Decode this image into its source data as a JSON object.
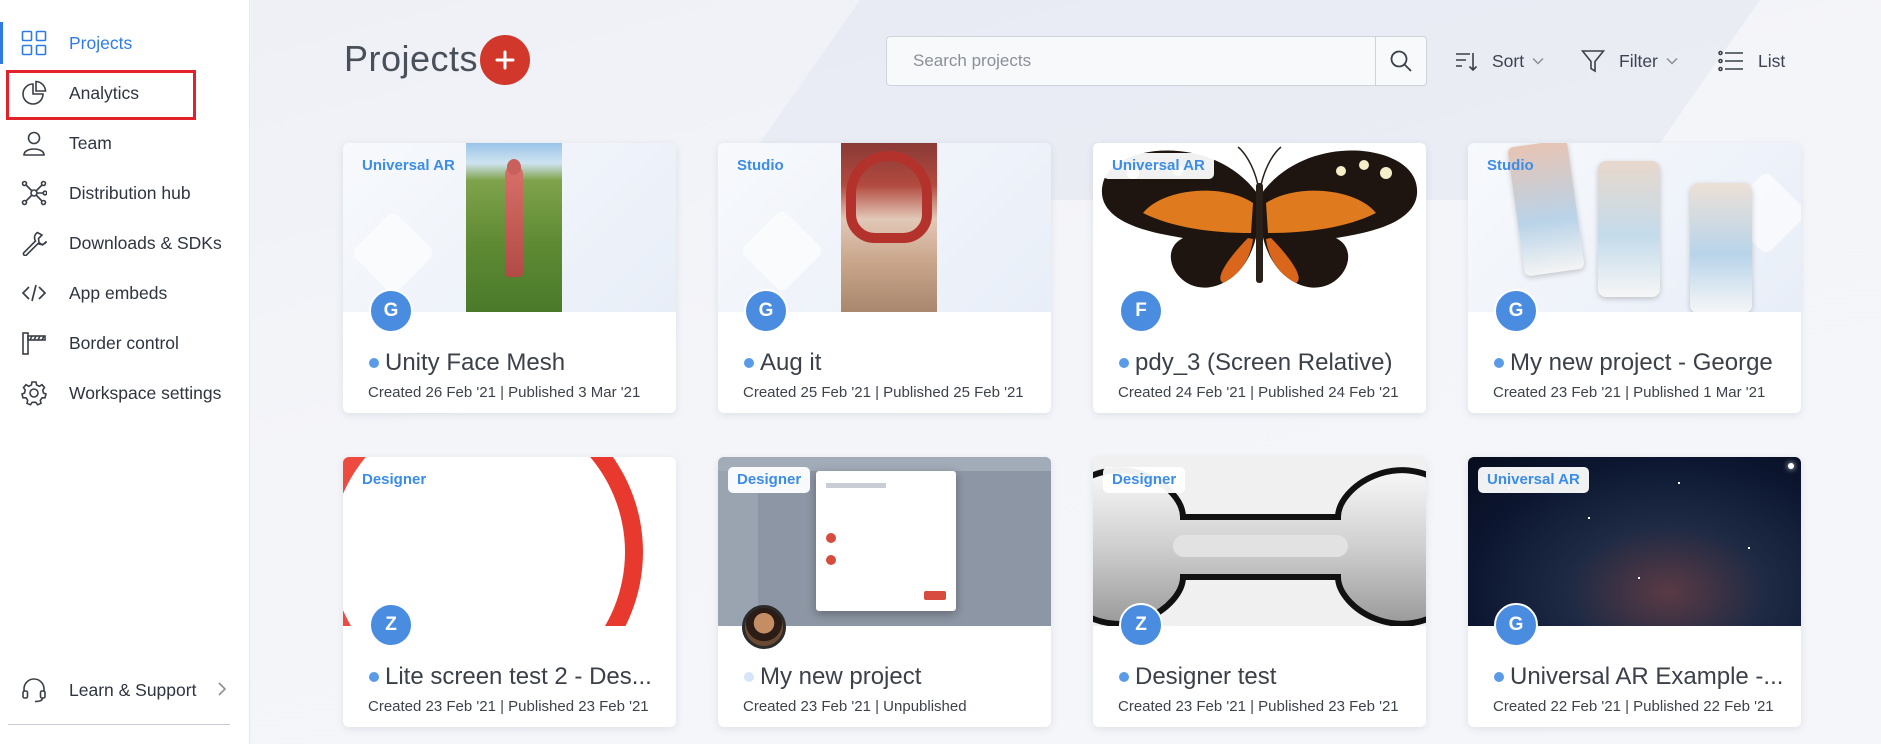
{
  "sidebar": {
    "items": [
      {
        "label": "Projects",
        "icon": "grid-icon",
        "active": true
      },
      {
        "label": "Analytics",
        "icon": "pie-chart-icon",
        "active": false
      },
      {
        "label": "Team",
        "icon": "user-icon",
        "active": false
      },
      {
        "label": "Distribution hub",
        "icon": "network-icon",
        "active": false
      },
      {
        "label": "Downloads & SDKs",
        "icon": "wrench-icon",
        "active": false
      },
      {
        "label": "App embeds",
        "icon": "code-icon",
        "active": false
      },
      {
        "label": "Border control",
        "icon": "barrier-icon",
        "active": false
      },
      {
        "label": "Workspace settings",
        "icon": "gear-icon",
        "active": false
      }
    ],
    "support": {
      "label": "Learn & Support",
      "icon": "headset-icon"
    }
  },
  "header": {
    "title": "Projects",
    "search_placeholder": "Search projects",
    "sort_label": "Sort",
    "filter_label": "Filter",
    "list_label": "List"
  },
  "projects": [
    {
      "tag": "Universal AR",
      "title": "Unity Face Mesh",
      "meta": "Created 26 Feb '21 | Published 3 Mar '21",
      "avatar": "G",
      "published": true
    },
    {
      "tag": "Studio",
      "title": "Aug it",
      "meta": "Created 25 Feb '21 | Published 25 Feb '21",
      "avatar": "G",
      "published": true
    },
    {
      "tag": "Universal AR",
      "title": "pdy_3 (Screen Relative)",
      "meta": "Created 24 Feb '21 | Published 24 Feb '21",
      "avatar": "F",
      "published": true
    },
    {
      "tag": "Studio",
      "title": "My new project - George",
      "meta": "Created 23 Feb '21 | Published 1 Mar '21",
      "avatar": "G",
      "published": true
    },
    {
      "tag": "Designer",
      "title": "Lite screen test 2 - Des...",
      "meta": "Created 23 Feb '21 | Published 23 Feb '21",
      "avatar": "Z",
      "published": true
    },
    {
      "tag": "Designer",
      "title": "My new project",
      "meta": "Created 23 Feb '21 | Unpublished",
      "avatar": "",
      "published": false
    },
    {
      "tag": "Designer",
      "title": "Designer test",
      "meta": "Created 23 Feb '21 | Published 23 Feb '21",
      "avatar": "Z",
      "published": true
    },
    {
      "tag": "Universal AR",
      "title": "Universal AR Example -...",
      "meta": "Created 22 Feb '21 | Published 22 Feb '21",
      "avatar": "G",
      "published": true
    }
  ],
  "colors": {
    "accent": "#2f7be5",
    "add_button": "#d2372b",
    "highlight": "#e2222a",
    "avatar": "#4a8ce0",
    "tag_text": "#3b8de6"
  }
}
